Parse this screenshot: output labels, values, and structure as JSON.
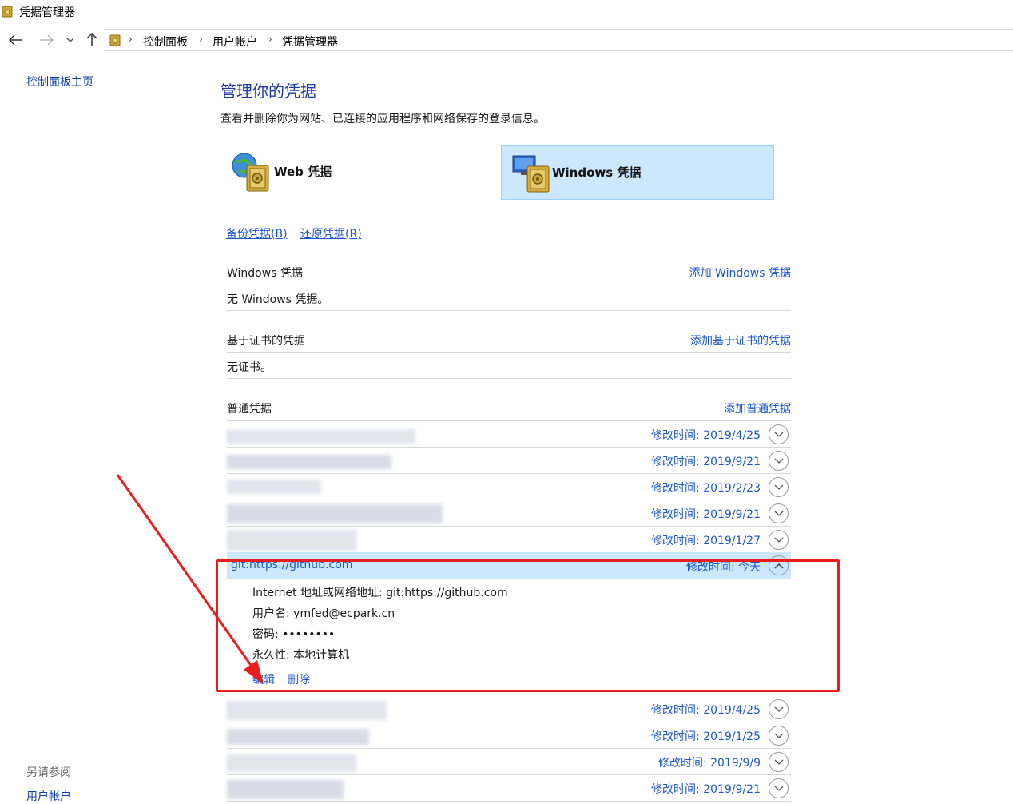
{
  "window": {
    "title": "凭据管理器"
  },
  "nav": {
    "breadcrumbs": [
      "控制面板",
      "用户帐户",
      "凭据管理器"
    ]
  },
  "left": {
    "home_link": "控制面板主页",
    "see_also_label": "另请参阅",
    "see_also_link": "用户帐户"
  },
  "main": {
    "title": "管理你的凭据",
    "subtitle": "查看并删除你为网站、已连接的应用程序和网络保存的登录信息。",
    "tab_web": "Web 凭据",
    "tab_windows": "Windows 凭据",
    "backup_link": "备份凭据(B)",
    "restore_link": "还原凭据(R)"
  },
  "sections": {
    "windows": {
      "title": "Windows 凭据",
      "add": "添加 Windows 凭据",
      "empty": "无 Windows 凭据。"
    },
    "certificate": {
      "title": "基于证书的凭据",
      "add": "添加基于证书的凭据",
      "empty": "无证书。"
    },
    "generic": {
      "title": "普通凭据",
      "add": "添加普通凭据"
    }
  },
  "credentials": {
    "rows_before": [
      {
        "date": "修改时间:  2019/4/25"
      },
      {
        "date": "修改时间:  2019/9/21"
      },
      {
        "date": "修改时间:  2019/2/23"
      },
      {
        "date": "修改时间:  2019/9/21"
      },
      {
        "date": "修改时间:  2019/1/27"
      }
    ],
    "expanded": {
      "name": "git:https://github.com",
      "date": "修改时间:  今天",
      "address": "Internet 地址或网络地址:  git:https://github.com",
      "username": "用户名:  ymfed@ecpark.cn",
      "password": "密码:  ••••••••",
      "persistence": "永久性:  本地计算机",
      "edit": "编辑",
      "delete": "删除"
    },
    "rows_after": [
      {
        "date": "修改时间:  2019/4/25"
      },
      {
        "date": "修改时间:  2019/1/25"
      },
      {
        "date": "修改时间:  2019/9/9"
      },
      {
        "date": "修改时间:  2019/9/21"
      }
    ]
  },
  "colors": {
    "link": "#1b56c9",
    "accent_bg": "#cce8ff",
    "annotation": "#ea1d1d"
  },
  "icons": [
    "back-arrow-icon",
    "forward-arrow-icon",
    "chevron-down-icon",
    "up-arrow-icon",
    "safe-icon",
    "globe-safe-icon",
    "monitor-safe-icon",
    "expand-chevron-icon",
    "collapse-chevron-icon"
  ]
}
